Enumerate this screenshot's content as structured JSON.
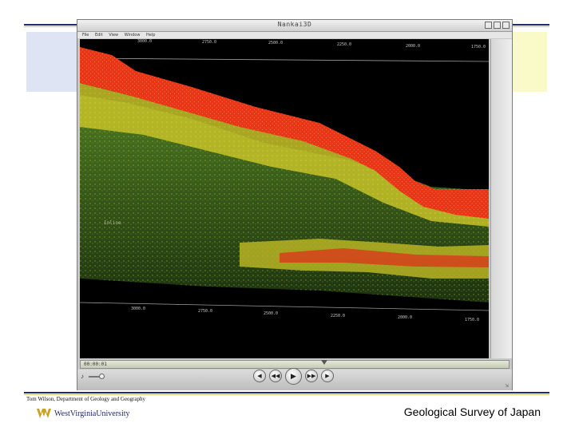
{
  "window": {
    "title": "Nankai3D",
    "menu": [
      "File",
      "Edit",
      "View",
      "Window",
      "Help"
    ]
  },
  "viewer": {
    "top_axis_ticks": [
      "3000.0",
      "2750.0",
      "2500.0",
      "2250.0",
      "2000.0",
      "1750.0"
    ],
    "bottom_axis_ticks": [
      "3000.0",
      "2750.0",
      "2500.0",
      "2250.0",
      "2000.0",
      "1750.0"
    ],
    "inline_label": "Inline"
  },
  "player": {
    "timecode": "00:00:01",
    "progress": 0.57,
    "volume": 0.8
  },
  "footer": {
    "credit": "Tom Wilson, Department of Geology and Geography",
    "university": "WestVirginiaUniversity",
    "source": "Geological Survey of Japan"
  },
  "colors": {
    "accent_navy": "#1f2a6b",
    "accent_gold": "#d8c56a",
    "seismic_red": "#e8341a",
    "seismic_yellow": "#d4d32a",
    "seismic_green": "#3f6b1e"
  }
}
